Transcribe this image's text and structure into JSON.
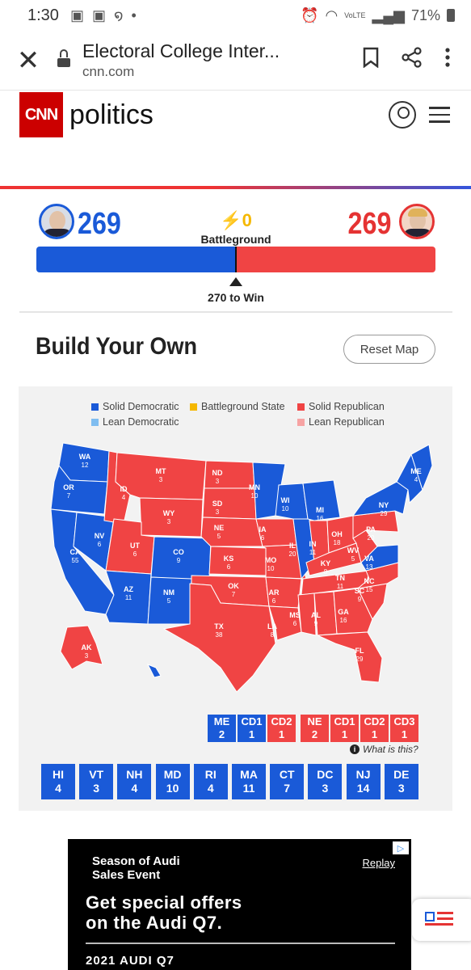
{
  "status": {
    "time": "1:30",
    "battery": "71%",
    "dot": "•",
    "network": "VoLTE"
  },
  "browser": {
    "title": "Electoral College Inter...",
    "host": "cnn.com"
  },
  "header": {
    "logo": "CNN",
    "section": "politics"
  },
  "tally": {
    "dem_votes": "269",
    "rep_votes": "269",
    "battleground_count": "0",
    "battleground_label": "Battleground",
    "to_win": "270 to Win",
    "dem_fraction": 0.5,
    "rep_fraction": 0.5
  },
  "build": {
    "title": "Build Your Own",
    "reset": "Reset Map"
  },
  "legend": [
    {
      "label": "Solid Democratic",
      "color": "#1a5ad8"
    },
    {
      "label": "Battleground State",
      "color": "#f5b800"
    },
    {
      "label": "Solid Republican",
      "color": "#f04444"
    },
    {
      "label": "Lean Democratic",
      "color": "#7fbdf0"
    },
    {
      "label": "Lean Republican",
      "color": "#f7a3a3"
    }
  ],
  "map_states": [
    {
      "abbr": "WA",
      "ev": "12",
      "party": "D"
    },
    {
      "abbr": "OR",
      "ev": "7",
      "party": "D"
    },
    {
      "abbr": "CA",
      "ev": "55",
      "party": "D"
    },
    {
      "abbr": "NV",
      "ev": "6",
      "party": "D"
    },
    {
      "abbr": "ID",
      "ev": "4",
      "party": "R"
    },
    {
      "abbr": "MT",
      "ev": "3",
      "party": "R"
    },
    {
      "abbr": "WY",
      "ev": "3",
      "party": "R"
    },
    {
      "abbr": "UT",
      "ev": "6",
      "party": "R"
    },
    {
      "abbr": "CO",
      "ev": "9",
      "party": "D"
    },
    {
      "abbr": "AZ",
      "ev": "11",
      "party": "D"
    },
    {
      "abbr": "NM",
      "ev": "5",
      "party": "D"
    },
    {
      "abbr": "ND",
      "ev": "3",
      "party": "R"
    },
    {
      "abbr": "SD",
      "ev": "3",
      "party": "R"
    },
    {
      "abbr": "NE",
      "ev": "5",
      "party": "R"
    },
    {
      "abbr": "KS",
      "ev": "6",
      "party": "R"
    },
    {
      "abbr": "OK",
      "ev": "7",
      "party": "R"
    },
    {
      "abbr": "TX",
      "ev": "38",
      "party": "R"
    },
    {
      "abbr": "MN",
      "ev": "10",
      "party": "D"
    },
    {
      "abbr": "IA",
      "ev": "6",
      "party": "R"
    },
    {
      "abbr": "MO",
      "ev": "10",
      "party": "R"
    },
    {
      "abbr": "AR",
      "ev": "6",
      "party": "R"
    },
    {
      "abbr": "LA",
      "ev": "8",
      "party": "R"
    },
    {
      "abbr": "WI",
      "ev": "10",
      "party": "D"
    },
    {
      "abbr": "IL",
      "ev": "20",
      "party": "D"
    },
    {
      "abbr": "MI",
      "ev": "16",
      "party": "D"
    },
    {
      "abbr": "IN",
      "ev": "11",
      "party": "R"
    },
    {
      "abbr": "OH",
      "ev": "18",
      "party": "R"
    },
    {
      "abbr": "KY",
      "ev": "8",
      "party": "R"
    },
    {
      "abbr": "TN",
      "ev": "11",
      "party": "R"
    },
    {
      "abbr": "MS",
      "ev": "6",
      "party": "R"
    },
    {
      "abbr": "AL",
      "ev": "9",
      "party": "R"
    },
    {
      "abbr": "GA",
      "ev": "16",
      "party": "R"
    },
    {
      "abbr": "FL",
      "ev": "29",
      "party": "R"
    },
    {
      "abbr": "SC",
      "ev": "9",
      "party": "R"
    },
    {
      "abbr": "NC",
      "ev": "15",
      "party": "R"
    },
    {
      "abbr": "VA",
      "ev": "13",
      "party": "D"
    },
    {
      "abbr": "WV",
      "ev": "5",
      "party": "R"
    },
    {
      "abbr": "PA",
      "ev": "20",
      "party": "R"
    },
    {
      "abbr": "NY",
      "ev": "29",
      "party": "D"
    },
    {
      "abbr": "ME",
      "ev": "4",
      "party": "D"
    },
    {
      "abbr": "AK",
      "ev": "3",
      "party": "R"
    }
  ],
  "districts": [
    {
      "label": "ME",
      "ev": "2",
      "party": "D"
    },
    {
      "label": "CD1",
      "ev": "1",
      "party": "D"
    },
    {
      "label": "CD2",
      "ev": "1",
      "party": "R"
    },
    {
      "label": "NE",
      "ev": "2",
      "party": "R"
    },
    {
      "label": "CD1",
      "ev": "1",
      "party": "R"
    },
    {
      "label": "CD2",
      "ev": "1",
      "party": "R"
    },
    {
      "label": "CD3",
      "ev": "1",
      "party": "R"
    }
  ],
  "what_is_this": "What is this?",
  "small_states": [
    {
      "label": "HI",
      "ev": "4",
      "party": "D"
    },
    {
      "label": "VT",
      "ev": "3",
      "party": "D"
    },
    {
      "label": "NH",
      "ev": "4",
      "party": "D"
    },
    {
      "label": "MD",
      "ev": "10",
      "party": "D"
    },
    {
      "label": "RI",
      "ev": "4",
      "party": "D"
    },
    {
      "label": "MA",
      "ev": "11",
      "party": "D"
    },
    {
      "label": "CT",
      "ev": "7",
      "party": "D"
    },
    {
      "label": "DC",
      "ev": "3",
      "party": "D"
    },
    {
      "label": "NJ",
      "ev": "14",
      "party": "D"
    },
    {
      "label": "DE",
      "ev": "3",
      "party": "D"
    }
  ],
  "ad": {
    "headline_line1": "Season of Audi",
    "headline_line2": "Sales Event",
    "replay": "Replay",
    "offer_line1": "Get special offers",
    "offer_line2": "on the Audi Q7.",
    "model": "2021 AUDI Q7"
  }
}
